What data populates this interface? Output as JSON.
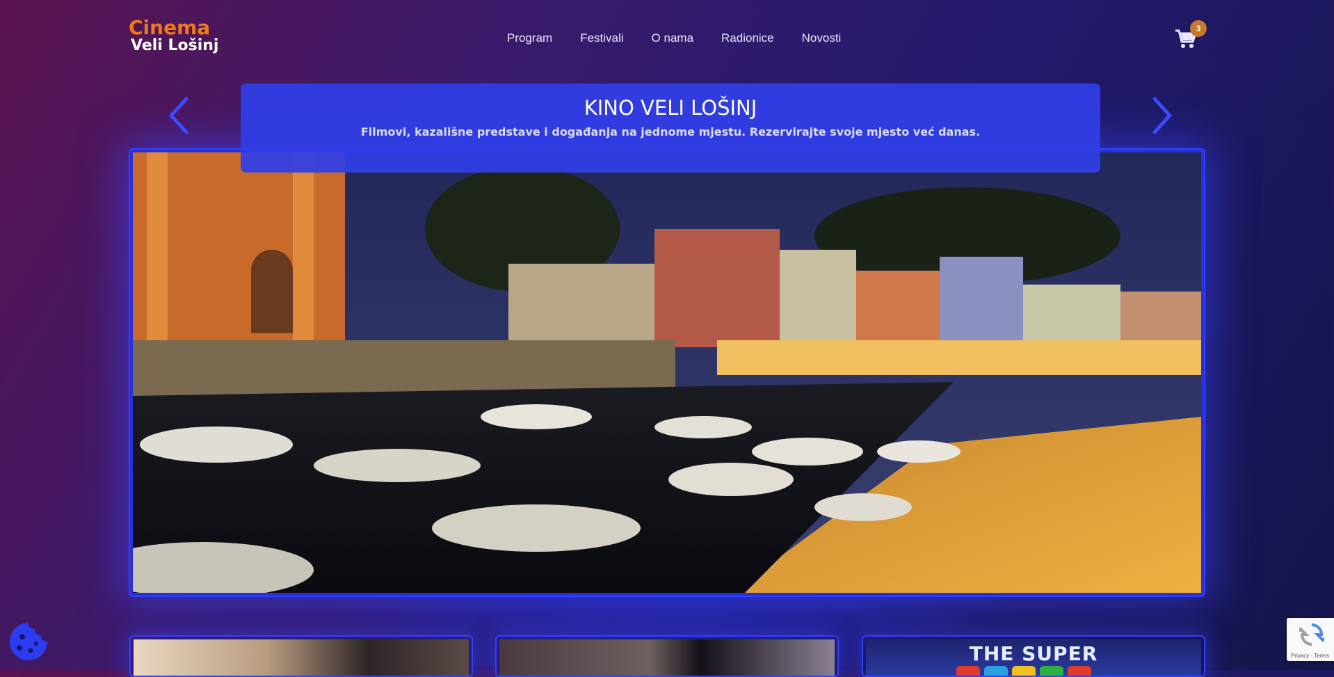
{
  "brand": {
    "line1": "Cinema",
    "line2": "Veli Lošinj"
  },
  "nav": {
    "items": [
      {
        "label": "Program"
      },
      {
        "label": "Festivali"
      },
      {
        "label": "O nama"
      },
      {
        "label": "Radionice"
      },
      {
        "label": "Novosti"
      }
    ]
  },
  "cart": {
    "icon": "cart-icon",
    "count": "3"
  },
  "hero": {
    "title": "KINO VELI LOŠINJ",
    "subtitle": "Filmovi, kazališne predstave i događanja na jednome mjestu. Rezervirajte svoje mjesto već danas.",
    "image_icon": "harbor-night-photo",
    "prev_icon": "chevron-left-icon",
    "next_icon": "chevron-right-icon"
  },
  "cards": [
    {
      "icon": "movie-poster-1"
    },
    {
      "icon": "movie-poster-2"
    },
    {
      "icon": "movie-poster-3",
      "title": "THE SUPER"
    }
  ],
  "recaptcha": {
    "text": "Privacy - Terms"
  },
  "cookie": {
    "icon": "cookie-icon"
  },
  "colors": {
    "accent": "#f07a18",
    "banner": "#303ee6",
    "glow": "#3040ff"
  }
}
